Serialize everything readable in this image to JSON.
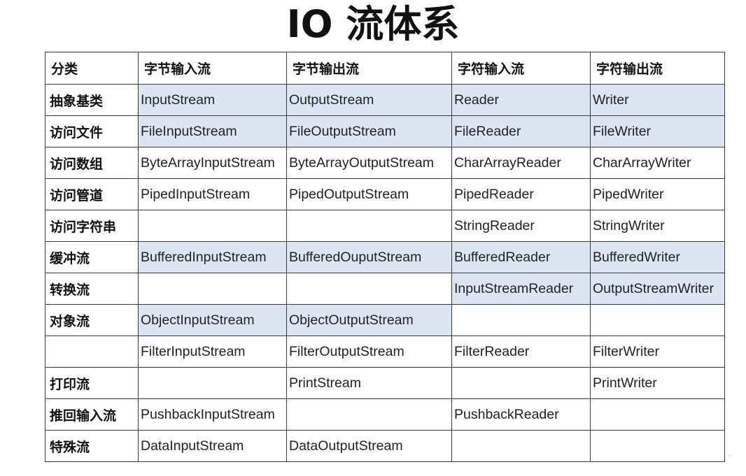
{
  "title": "IO 流体系",
  "table": {
    "headers": [
      "分类",
      "字节输入流",
      "字节输出流",
      "字符输入流",
      "字符输出流"
    ],
    "rows": [
      {
        "label": "抽象基类",
        "cells": [
          "InputStream",
          "OutputStream",
          "Reader",
          "Writer"
        ],
        "highlight": [
          true,
          true,
          true,
          true
        ]
      },
      {
        "label": "访问文件",
        "cells": [
          "FileInputStream",
          "FileOutputStream",
          "FileReader",
          "FileWriter"
        ],
        "highlight": [
          true,
          true,
          true,
          true
        ]
      },
      {
        "label": "访问数组",
        "cells": [
          "ByteArrayInputStream",
          "ByteArrayOutputStream",
          "CharArrayReader",
          "CharArrayWriter"
        ],
        "highlight": [
          false,
          false,
          false,
          false
        ]
      },
      {
        "label": "访问管道",
        "cells": [
          "PipedInputStream",
          "PipedOutputStream",
          "PipedReader",
          "PipedWriter"
        ],
        "highlight": [
          false,
          false,
          false,
          false
        ]
      },
      {
        "label": "访问字符串",
        "cells": [
          "",
          "",
          "StringReader",
          "StringWriter"
        ],
        "highlight": [
          false,
          false,
          false,
          false
        ]
      },
      {
        "label": "缓冲流",
        "cells": [
          "BufferedInputStream",
          "BufferedOuputStream",
          "BufferedReader",
          "BufferedWriter"
        ],
        "highlight": [
          true,
          true,
          true,
          true
        ]
      },
      {
        "label": "转换流",
        "cells": [
          "",
          "",
          "InputStreamReader",
          "OutputStreamWriter"
        ],
        "highlight": [
          false,
          false,
          true,
          true
        ]
      },
      {
        "label": "对象流",
        "cells": [
          "ObjectInputStream",
          "ObjectOutputStream",
          "",
          ""
        ],
        "highlight": [
          true,
          true,
          false,
          false
        ]
      },
      {
        "label": "",
        "cells": [
          "FilterInputStream",
          "FilterOutputStream",
          "FilterReader",
          "FilterWriter"
        ],
        "highlight": [
          false,
          false,
          false,
          false
        ]
      },
      {
        "label": "打印流",
        "cells": [
          "",
          "PrintStream",
          "",
          "PrintWriter"
        ],
        "highlight": [
          false,
          false,
          false,
          false
        ]
      },
      {
        "label": "推回输入流",
        "cells": [
          "PushbackInputStream",
          "",
          "PushbackReader",
          ""
        ],
        "highlight": [
          false,
          false,
          false,
          false
        ]
      },
      {
        "label": "特殊流",
        "cells": [
          "DataInputStream",
          "DataOutputStream",
          "",
          ""
        ],
        "highlight": [
          false,
          false,
          false,
          false
        ]
      }
    ]
  },
  "colors": {
    "highlight": "#dce6f2",
    "border": "#3a3a3a"
  }
}
